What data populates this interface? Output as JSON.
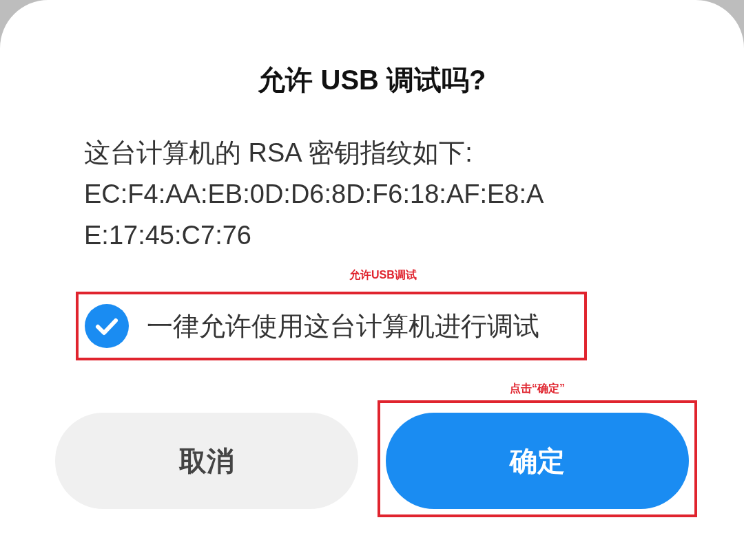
{
  "dialog": {
    "title": "允许 USB 调试吗?",
    "message_lines": [
      "这台计算机的 RSA 密钥指纹如下:",
      "EC:F4:AA:EB:0D:D6:8D:F6:18:AF:E8:A",
      "E:17:45:C7:76"
    ],
    "always_allow": {
      "label": "一律允许使用这台计算机进行调试",
      "checked": true,
      "annotation": "允许USB调试"
    },
    "buttons": [
      {
        "label": "取消",
        "kind": "secondary"
      },
      {
        "label": "确定",
        "kind": "primary",
        "annotation": "点击“确定”"
      }
    ]
  }
}
